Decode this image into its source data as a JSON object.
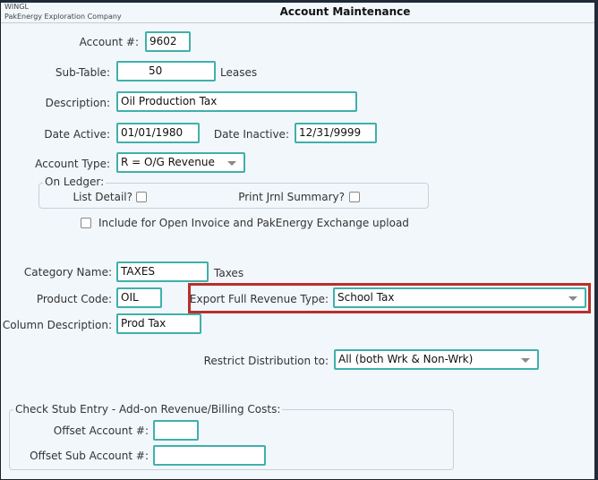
{
  "header": {
    "app_code": "WINGL",
    "company": "PakEnergy Exploration Company",
    "title": "Account Maintenance"
  },
  "form": {
    "account_number": {
      "label": "Account #:",
      "value": "9602"
    },
    "sub_table": {
      "label": "Sub-Table:",
      "value": "50",
      "suffix": "Leases"
    },
    "description": {
      "label": "Description:",
      "value": "Oil Production Tax"
    },
    "date_active": {
      "label": "Date Active:",
      "value": "01/01/1980"
    },
    "date_inactive": {
      "label": "Date Inactive:",
      "value": "12/31/9999"
    },
    "account_type": {
      "label": "Account Type:",
      "value": "R = O/G Revenue"
    },
    "on_ledger": {
      "legend": "On Ledger:",
      "list_detail": {
        "label": "List Detail?",
        "checked": false
      },
      "print_jrnl_summary": {
        "label": "Print Jrnl Summary?",
        "checked": false
      }
    },
    "include_open_invoice": {
      "label": "Include for Open Invoice and PakEnergy Exchange upload",
      "checked": false
    },
    "category_name": {
      "label": "Category Name:",
      "value": "TAXES",
      "suffix": "Taxes"
    },
    "product_code": {
      "label": "Product Code:",
      "value": "OIL"
    },
    "export_full_revenue_type": {
      "label": "Export Full Revenue Type:",
      "value": "School Tax"
    },
    "column_description": {
      "label": "Column Description:",
      "value": "Prod Tax"
    },
    "restrict_distribution": {
      "label": "Restrict Distribution to:",
      "value": "All (both Wrk & Non-Wrk)"
    },
    "check_stub": {
      "legend": "Check Stub Entry - Add-on Revenue/Billing Costs:",
      "offset_account": {
        "label": "Offset Account #:",
        "value": ""
      },
      "offset_sub_account": {
        "label": "Offset Sub Account #:",
        "value": ""
      }
    }
  },
  "colors": {
    "input_border": "#3fb0ab",
    "highlight_border": "#b8302a",
    "background": "#f2f7fc"
  }
}
